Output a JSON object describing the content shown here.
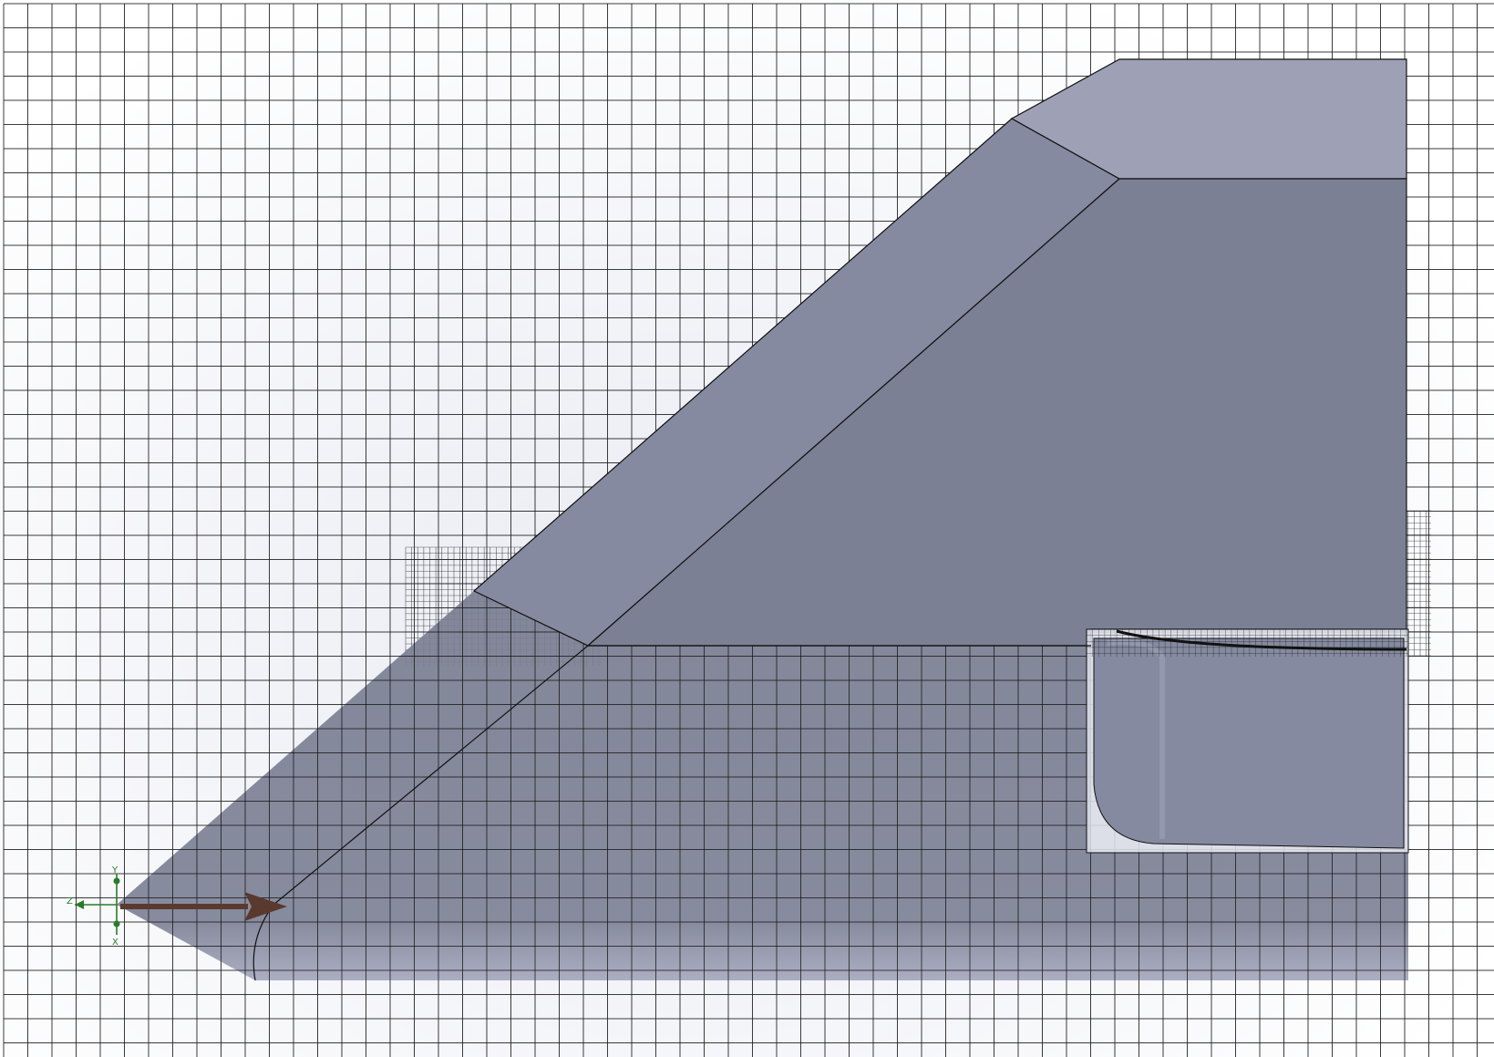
{
  "viewport": {
    "background_gradient": [
      "#e9ebf2",
      "#ffffff"
    ],
    "grid_color": "#1a1a1a"
  },
  "model": {
    "top_face_color": "#9ea1b6",
    "sloped_face_color": "#858aa0",
    "main_face_color": "#7c8094",
    "lower_face_color": "#7d8195",
    "edge_color": "#111111"
  },
  "triad": {
    "y_label": "Y",
    "z_label": "Z",
    "x_label": "X",
    "axis_color": "#2a7a2a"
  },
  "flow_arrow": {
    "color": "#5a3a2e",
    "icon": "flow-direction-arrow-icon"
  }
}
